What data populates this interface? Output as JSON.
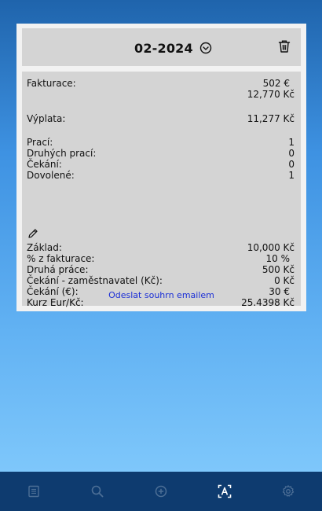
{
  "header": {
    "month": "02-2024"
  },
  "summary": {
    "fakturace_label": "Fakturace:",
    "fakturace_eur": "502 €",
    "fakturace_czk": "12,770 Kč",
    "vyplata_label": "Výplata:",
    "vyplata_value": "11,277 Kč",
    "counts": [
      {
        "label": "Prací:",
        "value": "1"
      },
      {
        "label": "Druhých prací:",
        "value": "0"
      },
      {
        "label": "Čekání:",
        "value": "0"
      },
      {
        "label": "Dovolené:",
        "value": "1"
      }
    ],
    "settings": [
      {
        "label": "Základ:",
        "value": "10,000 Kč"
      },
      {
        "label": "% z fakturace:",
        "value": "10 %"
      },
      {
        "label": "Druhá práce:",
        "value": "500 Kč"
      },
      {
        "label": "Čekání - zaměstnavatel (Kč):",
        "value": "0 Kč"
      },
      {
        "label": "Čekání (€):",
        "value": "30 €"
      },
      {
        "label": "Kurz Eur/Kč:",
        "value": "25.4398 Kč"
      }
    ],
    "email_link": "Odeslat souhrn emailem"
  },
  "nav": {
    "items": [
      {
        "name": "list-icon",
        "active": false
      },
      {
        "name": "search-icon",
        "active": false
      },
      {
        "name": "add-circle-icon",
        "active": false
      },
      {
        "name": "scan-text-icon",
        "active": true
      },
      {
        "name": "gear-icon",
        "active": false
      }
    ],
    "active_color": "#ffffff",
    "inactive_color": "#4d6f96"
  }
}
